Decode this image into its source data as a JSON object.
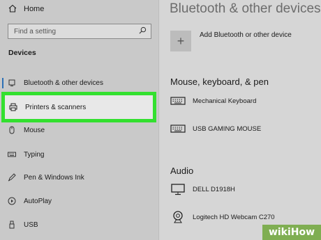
{
  "sidebar": {
    "home_label": "Home",
    "search_placeholder": "Find a setting",
    "section_title": "Devices",
    "items": [
      {
        "label": "Bluetooth & other devices",
        "icon": "bluetooth-icon"
      },
      {
        "label": "Printers & scanners",
        "icon": "printer-icon",
        "selected": true
      },
      {
        "label": "Mouse",
        "icon": "mouse-icon"
      },
      {
        "label": "Typing",
        "icon": "keyboard-icon"
      },
      {
        "label": "Pen & Windows Ink",
        "icon": "pen-icon"
      },
      {
        "label": "AutoPlay",
        "icon": "autoplay-icon"
      },
      {
        "label": "USB",
        "icon": "usb-icon"
      }
    ]
  },
  "main": {
    "title": "Bluetooth & other devices",
    "add_device_label": "Add Bluetooth or other device",
    "groups": [
      {
        "title": "Mouse, keyboard, & pen",
        "devices": [
          {
            "name": "Mechanical Keyboard",
            "icon": "keyboard-icon"
          },
          {
            "name": "USB GAMING MOUSE",
            "icon": "keyboard-icon"
          }
        ]
      },
      {
        "title": "Audio",
        "devices": [
          {
            "name": "DELL D1918H",
            "icon": "monitor-icon"
          },
          {
            "name": "Logitech HD Webcam C270",
            "icon": "webcam-icon"
          }
        ]
      }
    ]
  },
  "watermark": {
    "text": "wikiHow"
  },
  "colors": {
    "highlight": "#33e02f",
    "accent": "#2b6fb5",
    "sidebar_bg": "#c9c9c9",
    "content_bg": "#d6d6d6"
  }
}
